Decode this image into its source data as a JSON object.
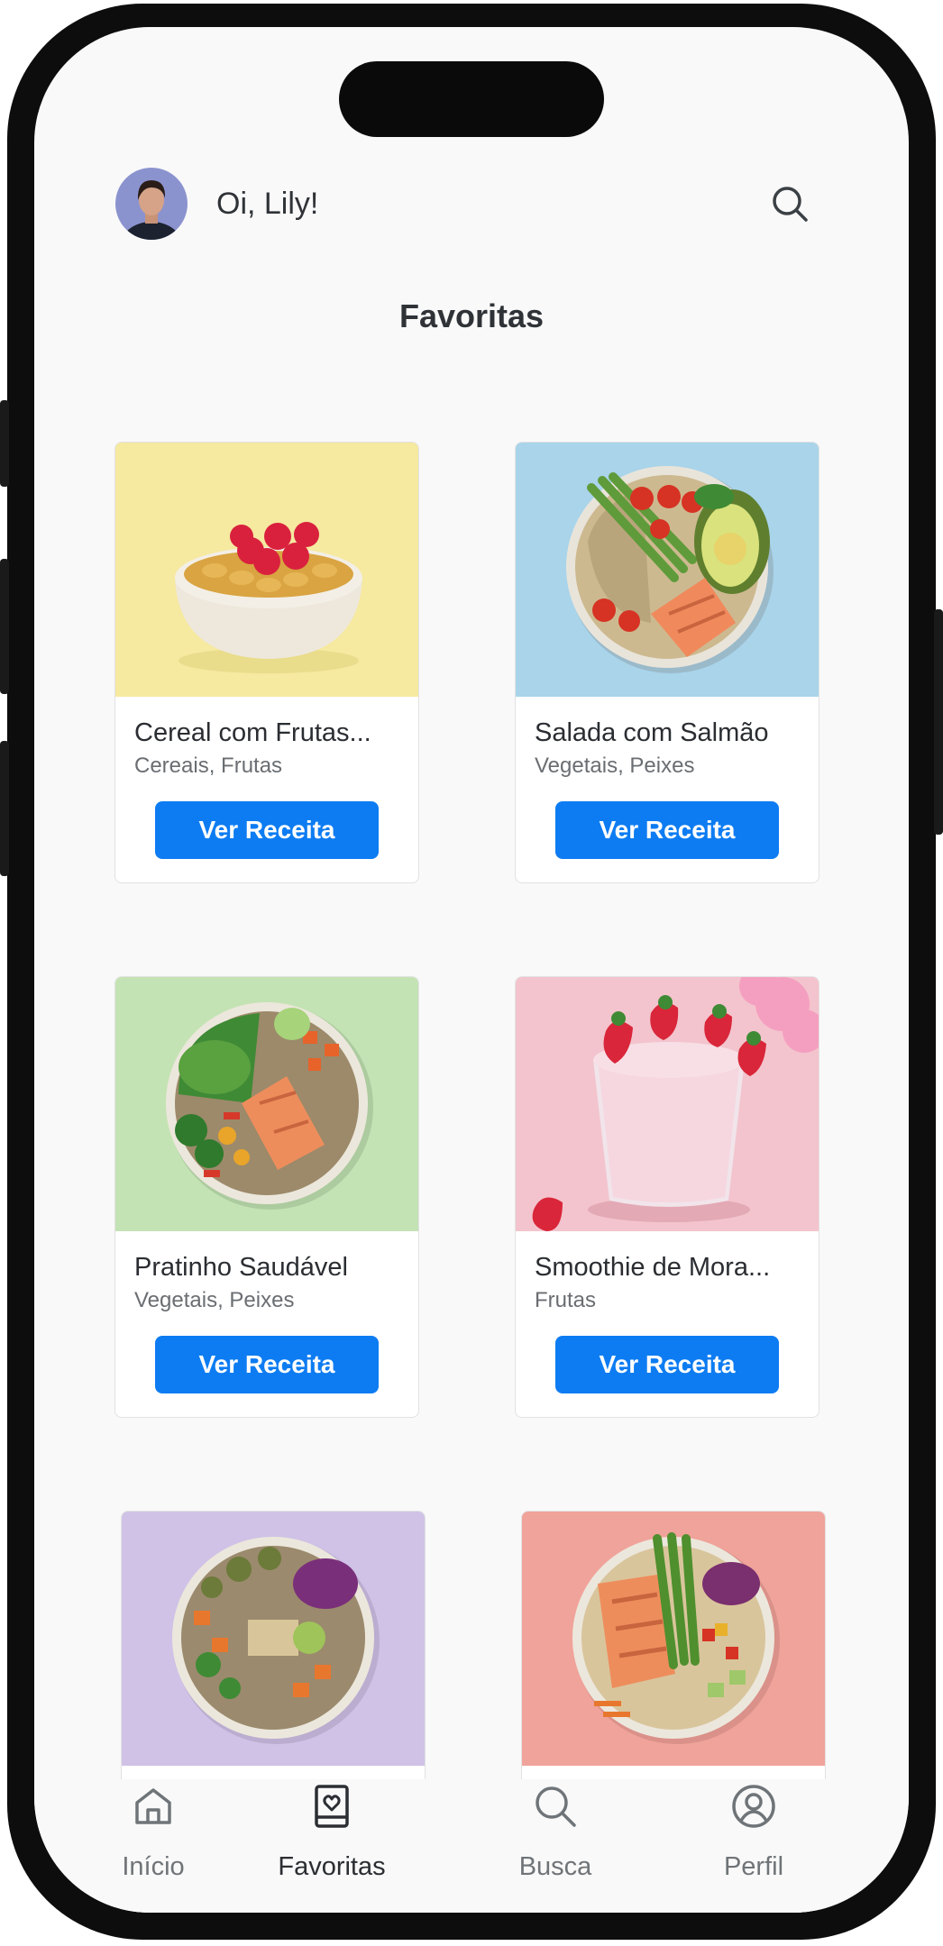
{
  "header": {
    "greeting": "Oi, Lily!",
    "avatar_icon": "user-avatar",
    "search_icon": "search-icon"
  },
  "page": {
    "title": "Favoritas"
  },
  "recipes": [
    {
      "title": "Cereal com Frutas...",
      "tags": "Cereais, Frutas",
      "button": "Ver Receita",
      "image_bg": "#f6e9a0"
    },
    {
      "title": "Salada com Salmão",
      "tags": "Vegetais, Peixes",
      "button": "Ver Receita",
      "image_bg": "#a9d4ea"
    },
    {
      "title": "Pratinho Saudável",
      "tags": "Vegetais, Peixes",
      "button": "Ver Receita",
      "image_bg": "#c4e3b4"
    },
    {
      "title": "Smoothie de Mora...",
      "tags": "Frutas",
      "button": "Ver Receita",
      "image_bg": "#f3c4cd"
    },
    {
      "title": "",
      "tags": "",
      "button": "",
      "image_bg": "#cfc2e6"
    },
    {
      "title": "",
      "tags": "",
      "button": "",
      "image_bg": "#f0a39a"
    }
  ],
  "nav": {
    "items": [
      {
        "label": "Início",
        "icon": "home-icon",
        "active": false
      },
      {
        "label": "Favoritas",
        "icon": "favorites-book-icon",
        "active": true
      },
      {
        "label": "Busca",
        "icon": "search-icon",
        "active": false
      },
      {
        "label": "Perfil",
        "icon": "profile-icon",
        "active": false
      }
    ]
  },
  "colors": {
    "accent": "#0d7cf2",
    "text": "#2f3337",
    "muted": "#6a6e72",
    "background": "#f9f9f9"
  }
}
